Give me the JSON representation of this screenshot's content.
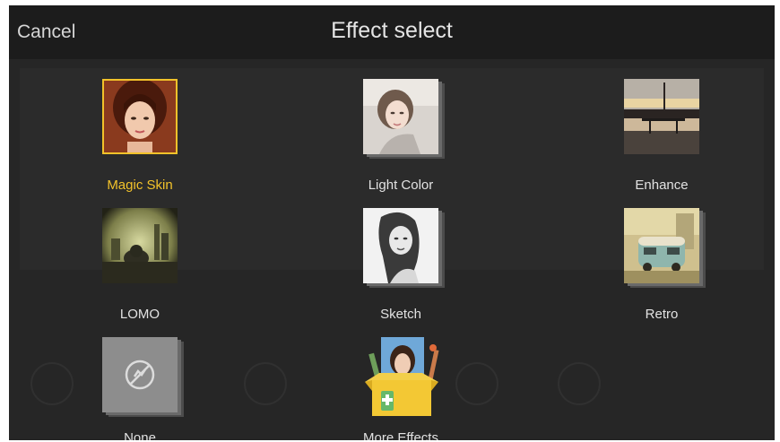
{
  "header": {
    "cancel_label": "Cancel",
    "title": "Effect select"
  },
  "effects": [
    {
      "label": "Magic Skin",
      "selected": true,
      "icon": "portrait-thumbnail"
    },
    {
      "label": "Light Color",
      "selected": false,
      "icon": "portrait-thumbnail"
    },
    {
      "label": "Enhance",
      "selected": false,
      "icon": "landscape-thumbnail"
    },
    {
      "label": "LOMO",
      "selected": false,
      "icon": "cityscape-thumbnail"
    },
    {
      "label": "Sketch",
      "selected": false,
      "icon": "portrait-thumbnail"
    },
    {
      "label": "Retro",
      "selected": false,
      "icon": "van-thumbnail"
    },
    {
      "label": "None",
      "selected": false,
      "icon": "no-effect-icon"
    },
    {
      "label": "More Effects",
      "selected": false,
      "icon": "store-box-icon"
    }
  ],
  "colors": {
    "accent": "#f2c22a",
    "background": "#262626",
    "text": "#e2e2e2"
  }
}
